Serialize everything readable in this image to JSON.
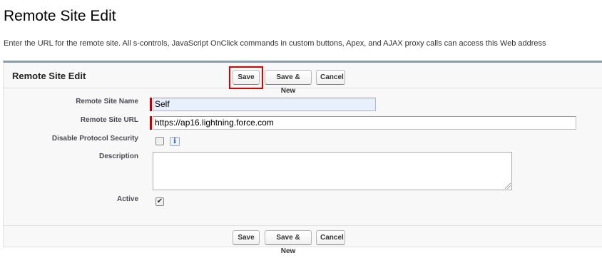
{
  "page": {
    "title": "Remote Site Edit",
    "intro": "Enter the URL for the remote site. All s-controls, JavaScript OnClick commands in custom buttons, Apex, and AJAX proxy calls can access this Web address"
  },
  "block": {
    "title": "Remote Site Edit",
    "buttons": {
      "save": "Save",
      "save_new": "Save & New",
      "cancel": "Cancel"
    }
  },
  "fields": {
    "name": {
      "label": "Remote Site Name",
      "value": "Self"
    },
    "url": {
      "label": "Remote Site URL",
      "value": "https://ap16.lightning.force.com"
    },
    "disable_security": {
      "label": "Disable Protocol Security",
      "checked": false,
      "info_icon": "i"
    },
    "description": {
      "label": "Description",
      "value": ""
    },
    "active": {
      "label": "Active",
      "checked": true,
      "check_glyph": "✔"
    }
  },
  "colors": {
    "required_marker": "#c00000",
    "highlight": "#e00000",
    "header_rule": "#8b9bb0"
  }
}
